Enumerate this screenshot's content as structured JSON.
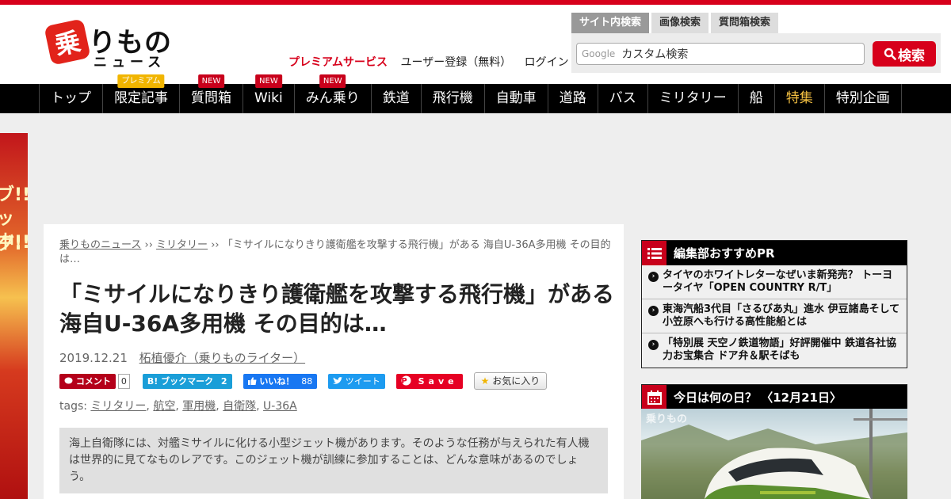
{
  "header": {
    "logo_badge": "乗",
    "logo_main": "りもの",
    "logo_sub": "ニュース",
    "premium_link": "プレミアムサービス",
    "register_link": "ユーザー登録（無料）",
    "login_link": "ログイン"
  },
  "search": {
    "tabs": [
      "サイト内検索",
      "画像検索",
      "質問箱検索"
    ],
    "google_label": "Google",
    "placeholder": "カスタム検索",
    "button_label": "検索"
  },
  "nav": {
    "items": [
      {
        "label": "トップ",
        "badge": ""
      },
      {
        "label": "限定記事",
        "badge": "プレミアム"
      },
      {
        "label": "質問箱",
        "badge": "NEW"
      },
      {
        "label": "Wiki",
        "badge": "NEW"
      },
      {
        "label": "みん乗り",
        "badge": "NEW"
      },
      {
        "label": "鉄道",
        "badge": ""
      },
      {
        "label": "飛行機",
        "badge": ""
      },
      {
        "label": "自動車",
        "badge": ""
      },
      {
        "label": "道路",
        "badge": ""
      },
      {
        "label": "バス",
        "badge": ""
      },
      {
        "label": "ミリタリー",
        "badge": ""
      },
      {
        "label": "船",
        "badge": ""
      },
      {
        "label": "特集",
        "badge": ""
      },
      {
        "label": "特別企画",
        "badge": ""
      }
    ]
  },
  "side_ad": {
    "line1": "ブ!!",
    "line2": "ッグ!",
    "line3": "中!!"
  },
  "article": {
    "breadcrumb": {
      "home": "乗りものニュース",
      "sep": "››",
      "category": "ミリタリー",
      "current": "「ミサイルになりきり護衛艦を攻撃する飛行機」がある 海自U-36A多用機 その目的は…"
    },
    "title": "「ミサイルになりきり護衛艦を攻撃する飛行機」がある 海自U-36A多用機 その目的は…",
    "date": "2019.12.21",
    "author": "柘植優介（乗りものライター）",
    "share": {
      "comment_label": "コメント",
      "comment_count": "0",
      "hatena_label": "B! ブックマーク",
      "hatena_count": "2",
      "like_label": "いいね！",
      "like_count": "88",
      "tweet_label": "ツイート",
      "save_label": "Save",
      "favorite_label": "お気に入り"
    },
    "tags_label": "tags:",
    "tags": [
      "ミリタリー",
      "航空",
      "軍用機",
      "自衛隊",
      "U-36A"
    ],
    "summary": "海上自衛隊には、対艦ミサイルに化ける小型ジェット機があります。そのような任務が与えられた有人機は世界的に見てなものレアです。このジェット機が訓練に参加することは、どんな意味があるのでしょう。"
  },
  "sidebar": {
    "pr_title": "編集部おすすめPR",
    "pr_items": [
      "タイヤのホワイトレターなぜいま新発売？ トーヨータイヤ「OPEN COUNTRY R/T」",
      "東海汽船3代目「さるびあ丸」進水 伊豆諸島そして小笠原へも行ける高性能船とは",
      "「特別展 天空ノ鉄道物語」好評開催中 鉄道各社協力お宝集合 ドア弁＆駅そばも"
    ],
    "today_title": "今日は何の日？ 〈12月21日〉",
    "photo_watermark": "乗りもの"
  },
  "colors": {
    "brand_red": "#d7001b",
    "nav_bg": "#000000",
    "special_nav": "#f5c142"
  }
}
